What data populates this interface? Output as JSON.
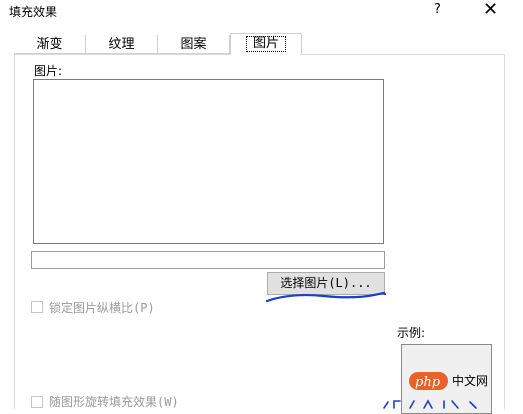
{
  "window": {
    "title": "填充效果",
    "help_label": "?",
    "close_label": "✕"
  },
  "tabs": [
    {
      "label": "渐变",
      "active": false
    },
    {
      "label": "纹理",
      "active": false
    },
    {
      "label": "图案",
      "active": false
    },
    {
      "label": "图片",
      "active": true
    }
  ],
  "picture": {
    "label": "图片:",
    "path_value": "",
    "select_button_label": "选择图片(L)..."
  },
  "options": {
    "lock_aspect_label": "锁定图片纵横比(P)",
    "lock_aspect_checked": false,
    "rotate_label": "随图形旋转填充效果(W)",
    "rotate_checked": false
  },
  "sample": {
    "label": "示例:"
  },
  "watermark": {
    "badge": "php",
    "text": "中文网"
  },
  "colors": {
    "annotation": "#1a3fd0",
    "watermark_badge": "#e8612a"
  }
}
